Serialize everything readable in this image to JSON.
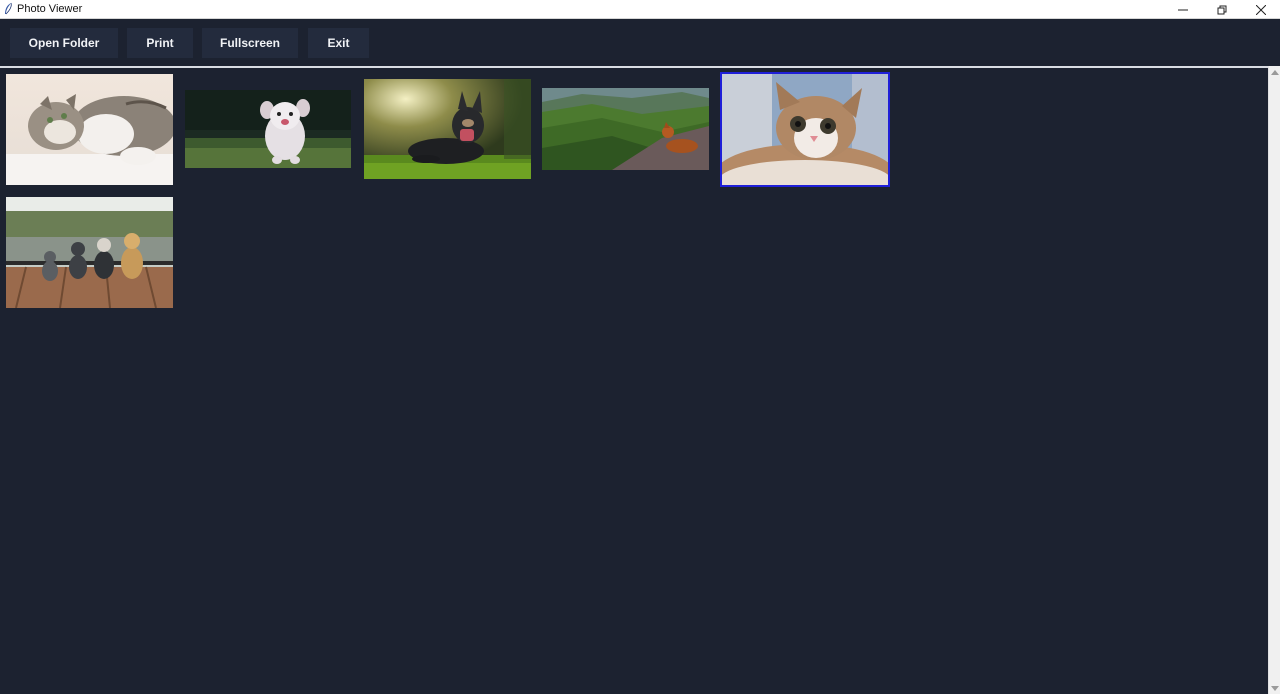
{
  "window": {
    "title": "Photo Viewer",
    "app_icon": "feather-icon",
    "controls": [
      "minimize-icon",
      "restore-icon",
      "close-icon"
    ]
  },
  "toolbar": {
    "open_folder": "Open Folder",
    "print": "Print",
    "fullscreen": "Fullscreen",
    "exit": "Exit"
  },
  "gallery": {
    "selected_index": 4,
    "thumbnails": [
      {
        "subject": "cat lying down"
      },
      {
        "subject": "white fluffy dog running"
      },
      {
        "subject": "black german shepherd lying in grass"
      },
      {
        "subject": "dog resting on mountain slope"
      },
      {
        "subject": "kitten close-up"
      },
      {
        "subject": "four dogs sitting on a dock"
      }
    ]
  },
  "colors": {
    "background": "#1c2230",
    "button": "#232b3d",
    "selection": "#1f1fd8"
  }
}
